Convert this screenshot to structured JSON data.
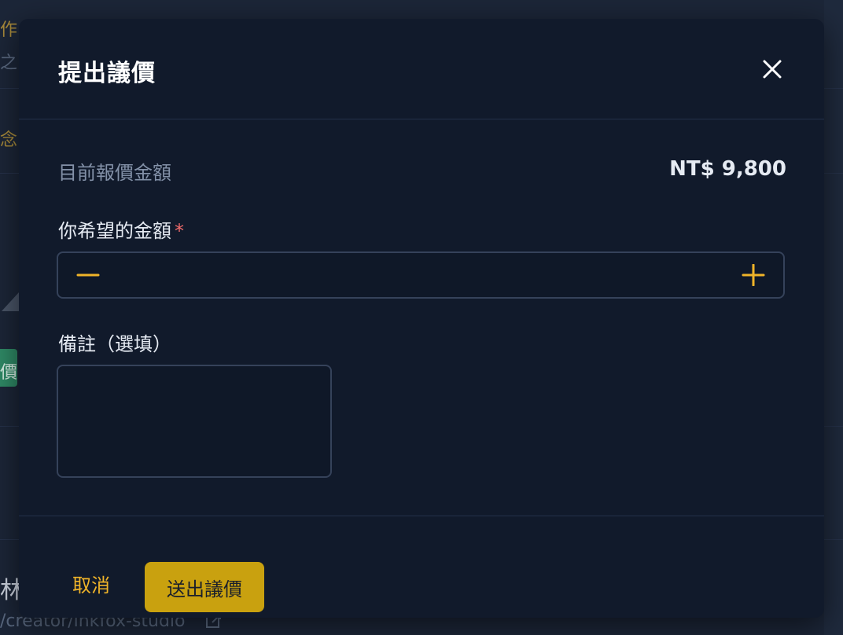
{
  "background": {
    "fragments": [
      "作",
      "之",
      "念",
      "價",
      "林",
      "/creator/inkfox-studio"
    ],
    "accent_color": "#c9a10f",
    "badge_color": "#2f8a66"
  },
  "modal": {
    "title": "提出議價",
    "close_icon": "close-icon"
  },
  "current_offer": {
    "label": "目前報價金額",
    "value": "NT$ 9,800"
  },
  "desired_amount": {
    "label": "你希望的金額",
    "required_mark": "*",
    "value": "",
    "minus_icon": "minus-icon",
    "plus_icon": "plus-icon"
  },
  "note": {
    "label": "備註（選填）",
    "value": ""
  },
  "footer": {
    "cancel_label": "取消",
    "submit_label": "送出議價"
  },
  "colors": {
    "accent": "#f0b429",
    "button": "#c9a10f",
    "required": "#f06b6b",
    "modal_bg": "#111a2b"
  }
}
